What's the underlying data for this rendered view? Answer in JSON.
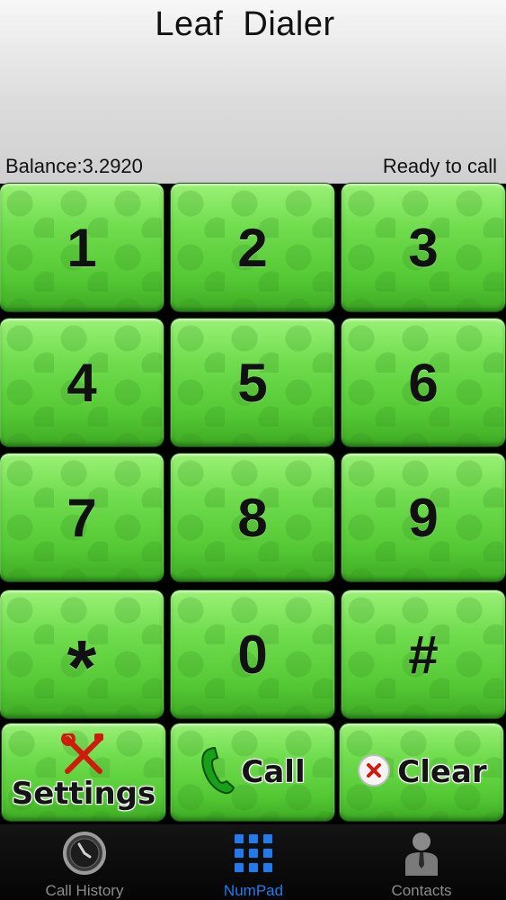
{
  "app": {
    "title": "Leaf  Dialer",
    "balance": "Balance:3.2920",
    "status": "Ready to call"
  },
  "keypad": {
    "keys": [
      "1",
      "2",
      "3",
      "4",
      "5",
      "6",
      "7",
      "8",
      "9",
      "*",
      "0",
      "#"
    ]
  },
  "actions": {
    "settings_label": "Settings",
    "call_label": "Call",
    "clear_label": "Clear"
  },
  "tabs": {
    "call_history": "Call History",
    "numpad": "NumPad",
    "contacts": "Contacts"
  },
  "colors": {
    "key_green": "#6fdc4d",
    "active_tab": "#1e7cf0",
    "inactive_tab": "#8d8d8d"
  },
  "icons": [
    "clock-icon",
    "grid-icon",
    "person-icon",
    "wrench-screwdriver-icon",
    "phone-handset-icon",
    "clear-x-icon"
  ]
}
